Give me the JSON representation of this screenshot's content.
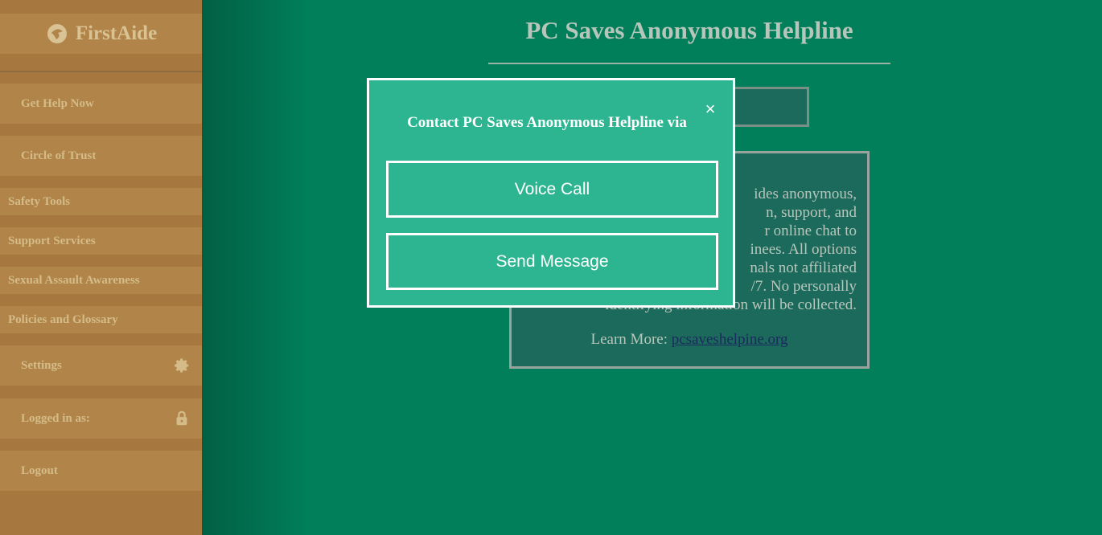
{
  "sidebar": {
    "app_name": "FirstAide",
    "items": [
      {
        "label": "Get Help Now"
      },
      {
        "label": "Circle of Trust"
      },
      {
        "label": "Safety Tools"
      },
      {
        "label": "Support Services"
      },
      {
        "label": "Sexual Assault Awareness"
      },
      {
        "label": "Policies and Glossary"
      },
      {
        "label": "Settings",
        "icon": "gear-icon"
      },
      {
        "label": "Logged in as:",
        "icon": "lock-icon"
      },
      {
        "label": "Logout"
      }
    ]
  },
  "page": {
    "title": "PC Saves Anonymous Helpline",
    "info_lines": [
      "ides anonymous,",
      "n, support, and",
      "r online chat to",
      "inees. All options",
      "nals not affiliated",
      "/7. No personally",
      "identifying information will be collected."
    ],
    "learn_more_label": "Learn More:",
    "learn_more_link": "pcsaveshelpine.org"
  },
  "modal": {
    "title": "Contact PC Saves Anonymous Helpline via",
    "close_label": "×",
    "voice_call_label": "Voice Call",
    "send_message_label": "Send Message"
  },
  "colors": {
    "background": "#017e5a",
    "sidebar": "#a6783f",
    "modal": "#2cb590"
  }
}
